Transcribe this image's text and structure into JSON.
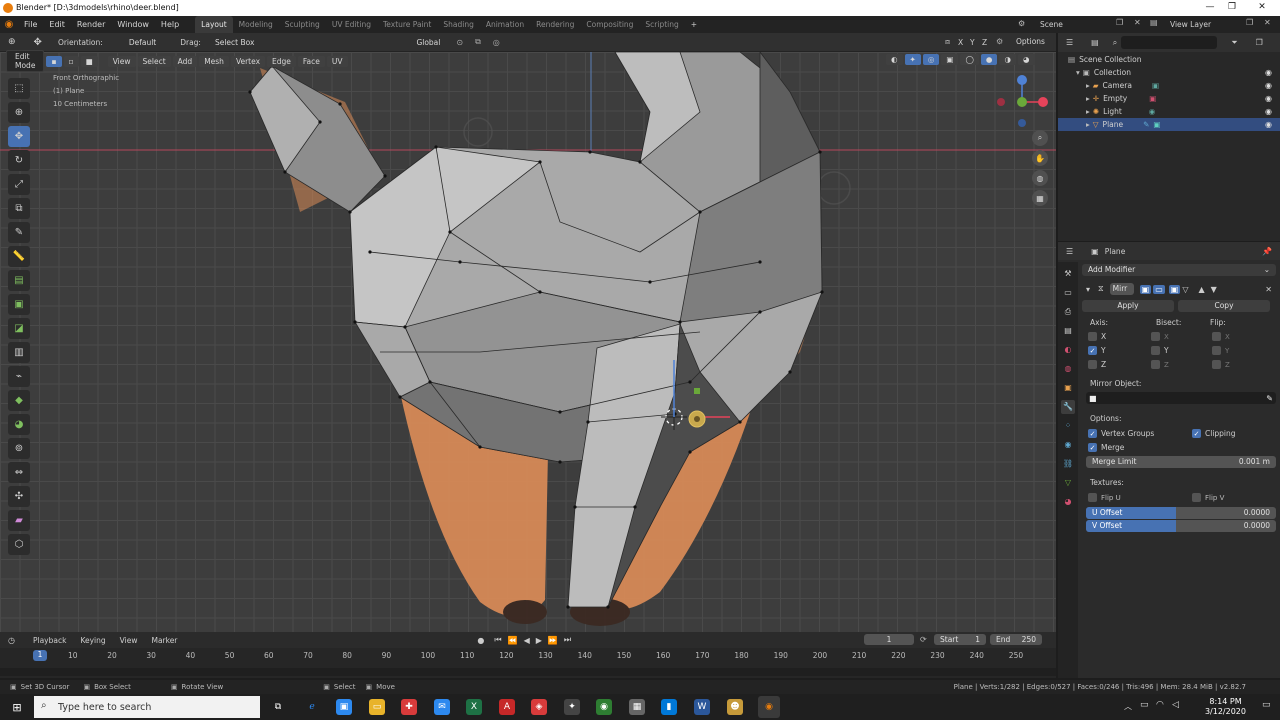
{
  "window": {
    "title": "Blender* [D:\\3dmodels\\rhino\\deer.blend]",
    "controls": [
      "—",
      "❐",
      "✕"
    ]
  },
  "menu": [
    "File",
    "Edit",
    "Render",
    "Window",
    "Help"
  ],
  "workspaces": [
    "Layout",
    "Modeling",
    "Sculpting",
    "UV Editing",
    "Texture Paint",
    "Shading",
    "Animation",
    "Rendering",
    "Compositing",
    "Scripting"
  ],
  "workspace_add": "+",
  "scene": {
    "name": "Scene",
    "view_layer": "View Layer"
  },
  "viewport_header": {
    "orientation_label": "Orientation:",
    "orientation_value": "Default",
    "drag_label": "Drag:",
    "drag_value": "Select Box",
    "transform_orientation": "Global",
    "axes": [
      "X",
      "Y",
      "Z"
    ],
    "options": "Options"
  },
  "edit_header": {
    "mode": "Edit Mode",
    "menus": [
      "View",
      "Select",
      "Add",
      "Mesh",
      "Vertex",
      "Edge",
      "Face",
      "UV"
    ]
  },
  "viewport_info": {
    "view": "Front Orthographic",
    "object": "(1) Plane",
    "scale": "10 Centimeters"
  },
  "tools": [
    "select-box",
    "cursor",
    "move",
    "rotate",
    "scale",
    "transform",
    "annotate",
    "measure",
    "extrude",
    "inset",
    "bevel",
    "loop-cut",
    "knife",
    "poly-build",
    "spin",
    "smooth",
    "edge-slide",
    "shrink-fatten",
    "shear",
    "rip"
  ],
  "outliner": {
    "root": "Scene Collection",
    "collection": "Collection",
    "items": [
      {
        "name": "Camera",
        "selected": false,
        "color": "#e8a14f"
      },
      {
        "name": "Empty",
        "selected": false,
        "color": "#e8a14f"
      },
      {
        "name": "Light",
        "selected": false,
        "color": "#e8a14f"
      },
      {
        "name": "Plane",
        "selected": true,
        "color": "#e8a14f"
      }
    ]
  },
  "properties": {
    "object_name": "Plane",
    "add_modifier": "Add Modifier",
    "modifier_name": "Mirr",
    "apply": "Apply",
    "copy": "Copy",
    "axis_label": "Axis:",
    "bisect_label": "Bisect:",
    "flip_label": "Flip:",
    "axis": [
      {
        "name": "X",
        "on": false
      },
      {
        "name": "Y",
        "on": true
      },
      {
        "name": "Z",
        "on": false
      }
    ],
    "mirror_object_label": "Mirror Object:",
    "options_label": "Options:",
    "vertex_groups": "Vertex Groups",
    "clipping": "Clipping",
    "merge": "Merge",
    "merge_limit_label": "Merge Limit",
    "merge_limit_value": "0.001 m",
    "textures_label": "Textures:",
    "flip_u": "Flip U",
    "flip_v": "Flip V",
    "u_offset_label": "U Offset",
    "u_offset_value": "0.0000",
    "v_offset_label": "V Offset",
    "v_offset_value": "0.0000"
  },
  "timeline": {
    "menus": [
      "Playback",
      "Keying",
      "View",
      "Marker"
    ],
    "current_frame": "1",
    "start_label": "Start",
    "start_value": "1",
    "end_label": "End",
    "end_value": "250",
    "ticks": [
      "10",
      "20",
      "30",
      "40",
      "50",
      "60",
      "70",
      "80",
      "90",
      "100",
      "110",
      "120",
      "130",
      "140",
      "150",
      "160",
      "170",
      "180",
      "190",
      "200",
      "210",
      "220",
      "230",
      "240",
      "250"
    ],
    "cursor_frame": "1"
  },
  "statusbar": {
    "hints": [
      "Set 3D Cursor",
      "Box Select",
      "Rotate View",
      "Select",
      "Move"
    ],
    "stats": "Plane | Verts:1/282 | Edges:0/527 | Faces:0/246 | Tris:496 | Mem: 28.4 MiB | v2.82.7"
  },
  "taskbar": {
    "search_placeholder": "Type here to search",
    "time": "8:14 PM",
    "date": "3/12/2020"
  },
  "colors": {
    "accent": "#4772b3",
    "selection": "#334d80",
    "mesh_light": "#b4b4b4",
    "mesh_dark": "#6a6a6a",
    "reference": "#d68a57",
    "object_orange": "#e87d0d"
  }
}
